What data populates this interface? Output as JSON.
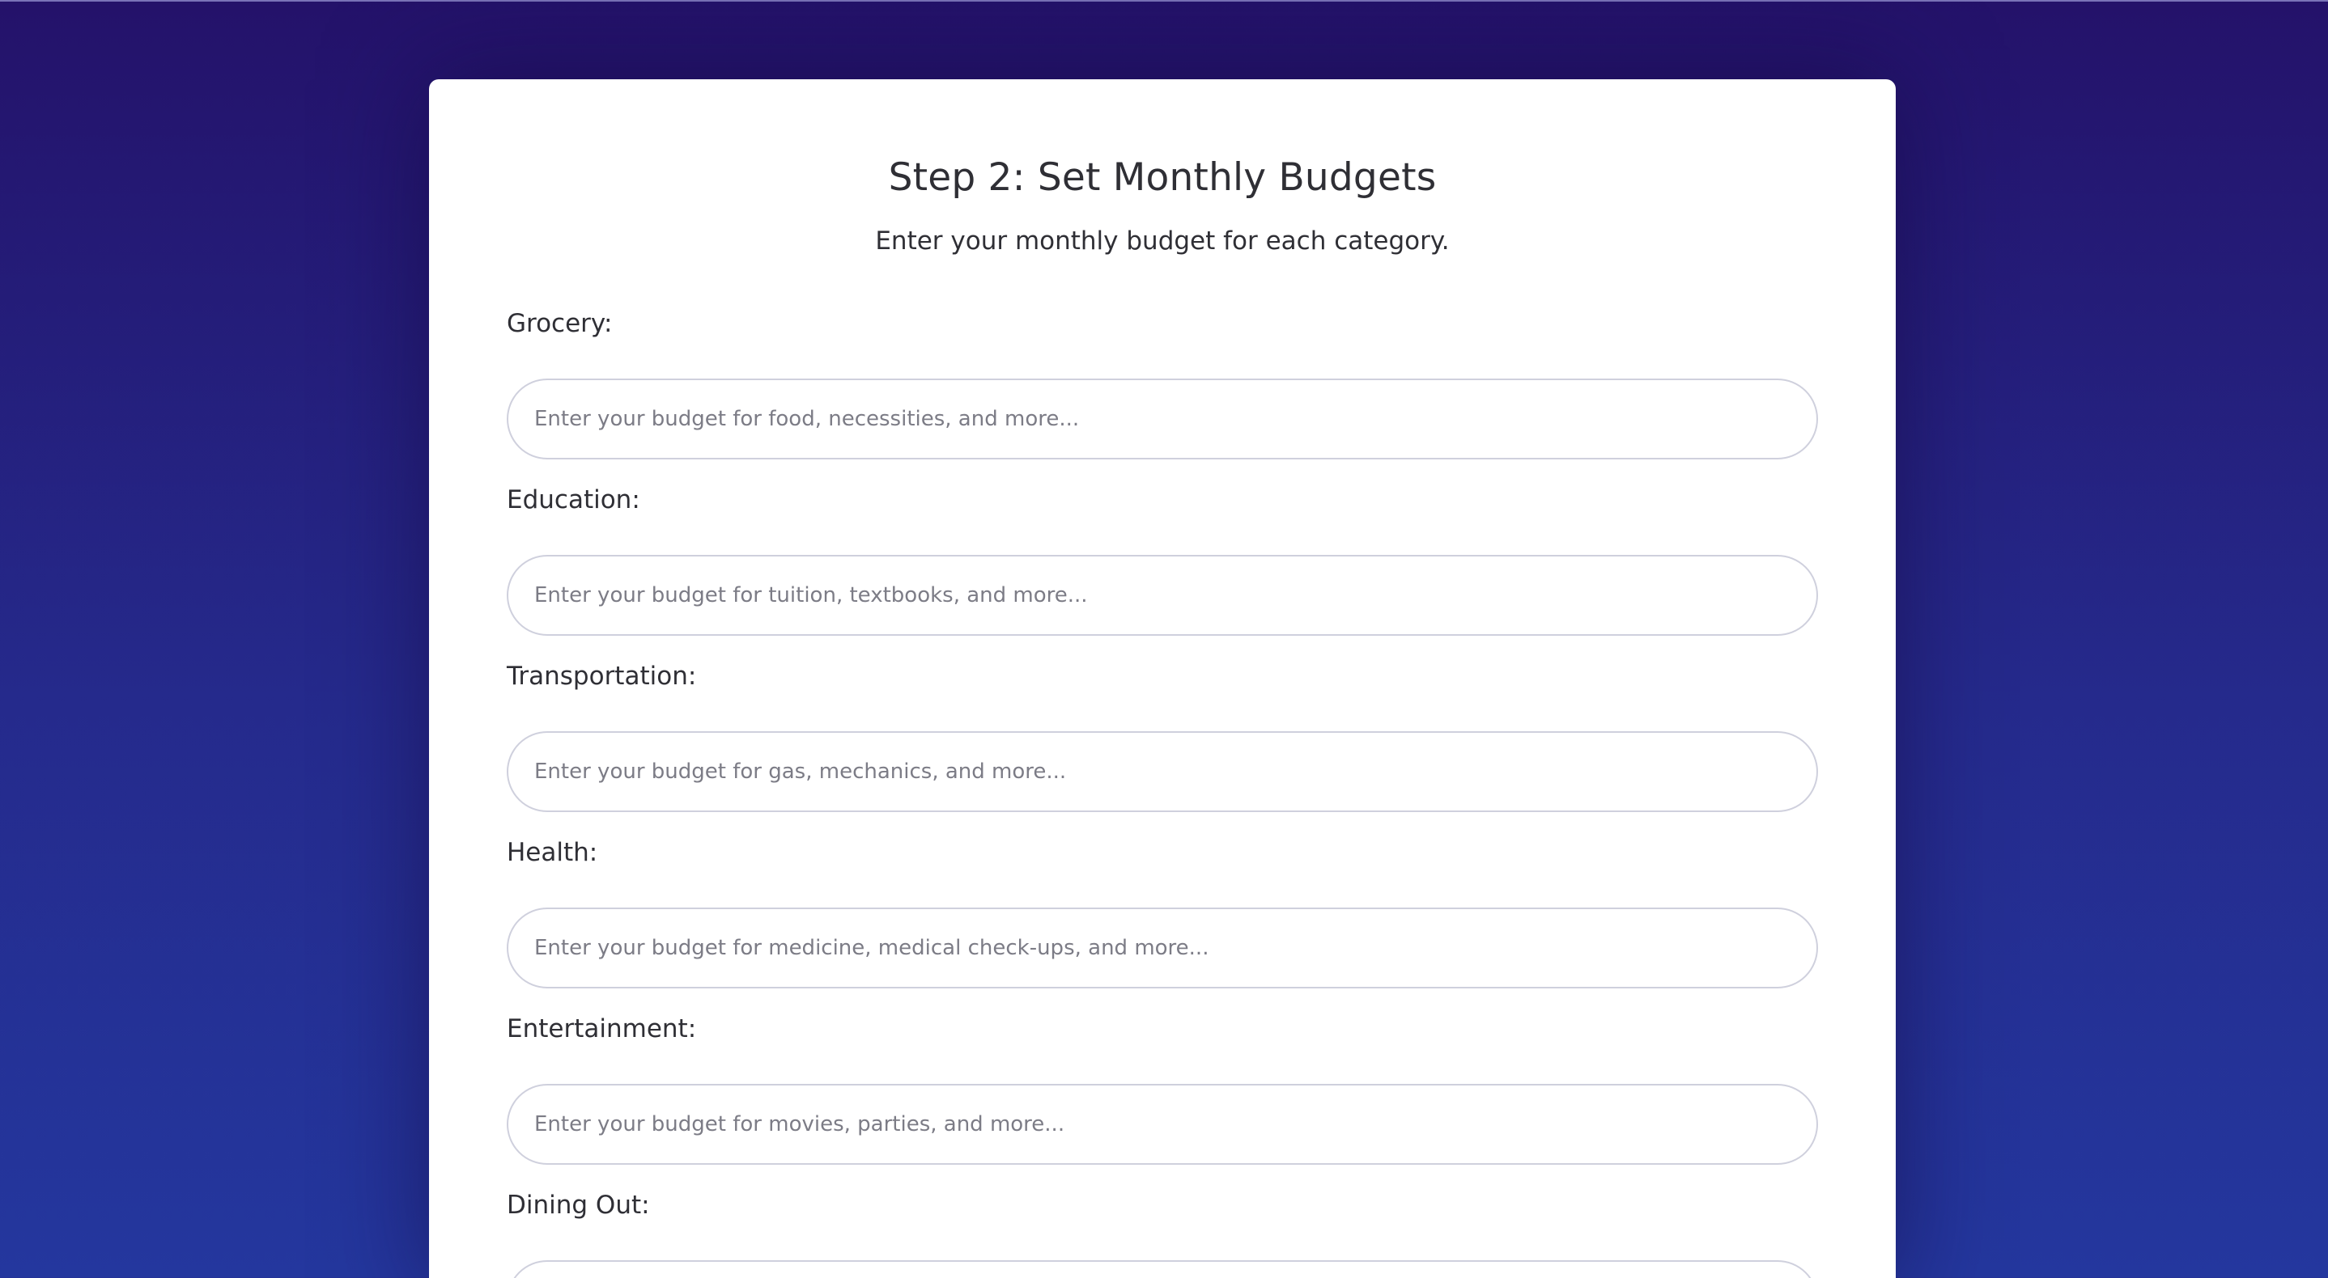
{
  "page": {
    "title": "Step 2: Set Monthly Budgets",
    "subtitle": "Enter your monthly budget for each category."
  },
  "fields": [
    {
      "label": "Grocery:",
      "value": "",
      "placeholder": "Enter your budget for food, necessities, and more..."
    },
    {
      "label": "Education:",
      "value": "",
      "placeholder": "Enter your budget for tuition, textbooks, and more..."
    },
    {
      "label": "Transportation:",
      "value": "",
      "placeholder": "Enter your budget for gas, mechanics, and more..."
    },
    {
      "label": "Health:",
      "value": "",
      "placeholder": "Enter your budget for medicine, medical check-ups, and more..."
    },
    {
      "label": "Entertainment:",
      "value": "",
      "placeholder": "Enter your budget for movies, parties, and more..."
    },
    {
      "label": "Dining Out:",
      "value": "",
      "placeholder": ""
    }
  ],
  "colors": {
    "background_top": "#24126a",
    "background_bottom": "#24379e",
    "card": "#ffffff",
    "text": "#2f2f35",
    "input_border": "#cfd0dd",
    "placeholder": "#7c7c86"
  }
}
